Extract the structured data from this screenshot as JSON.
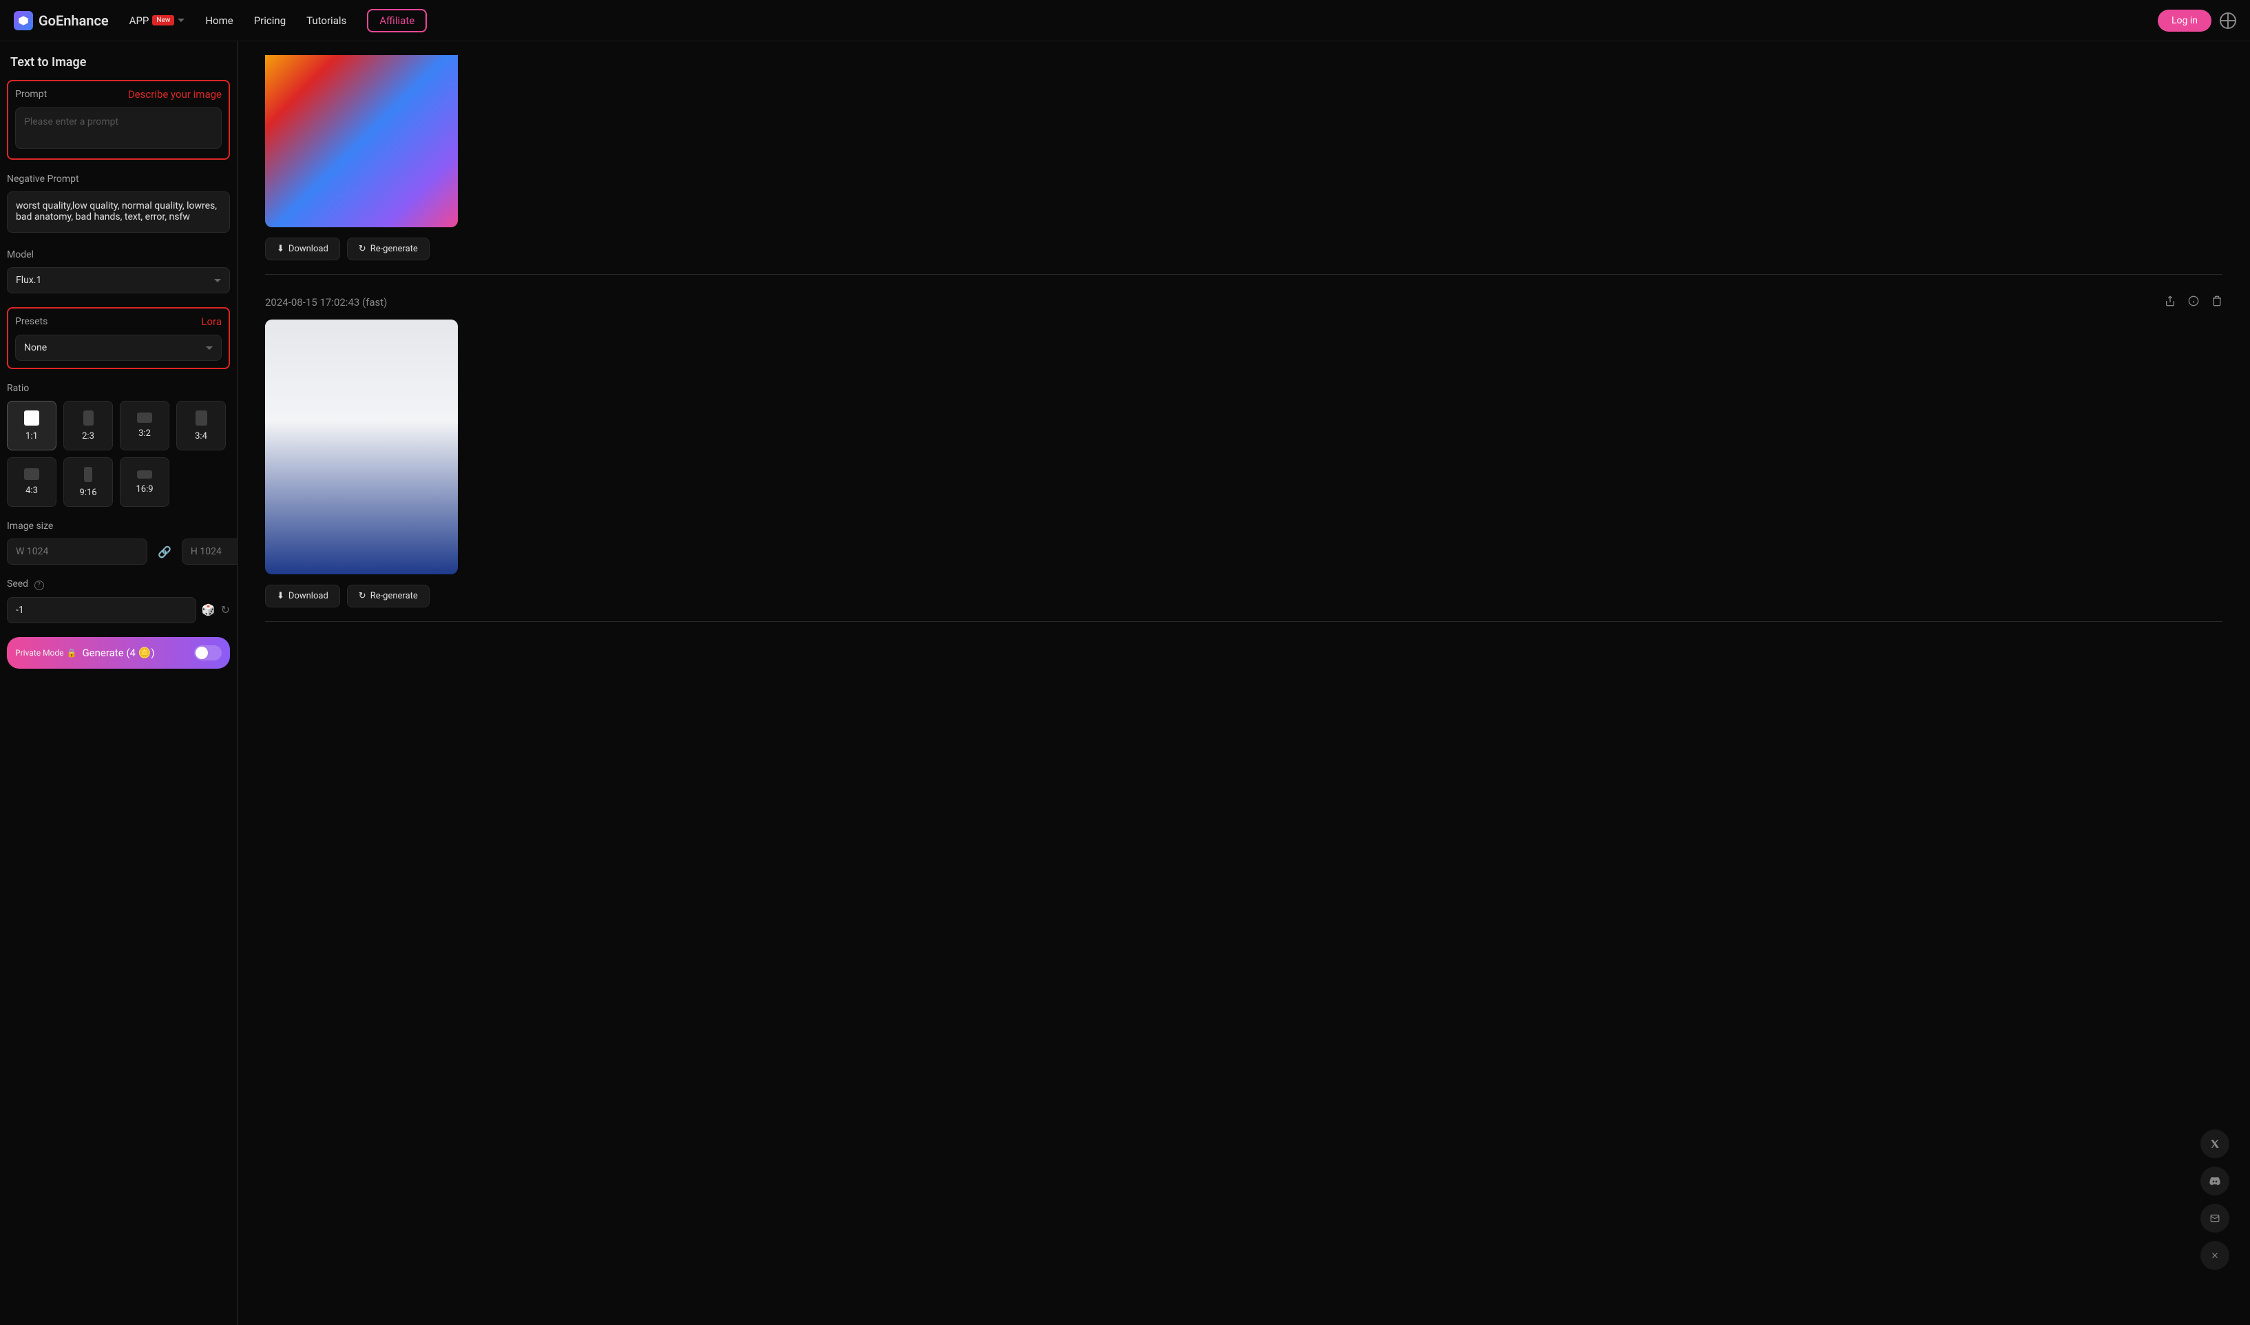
{
  "header": {
    "logo_text": "GoEnhance",
    "app_label": "APP",
    "new_badge": "New",
    "nav": {
      "home": "Home",
      "pricing": "Pricing",
      "tutorials": "Tutorials",
      "affiliate": "Affiliate"
    },
    "login": "Log in"
  },
  "sidebar": {
    "title": "Text to Image",
    "prompt": {
      "label": "Prompt",
      "callout": "Describe your image",
      "placeholder": "Please enter a prompt",
      "value": ""
    },
    "negative_prompt": {
      "label": "Negative Prompt",
      "value": "worst quality,low quality, normal quality, lowres, bad anatomy, bad hands, text, error, nsfw"
    },
    "model": {
      "label": "Model",
      "value": "Flux.1"
    },
    "presets": {
      "label": "Presets",
      "callout": "Lora",
      "value": "None"
    },
    "ratio": {
      "label": "Ratio",
      "options": [
        "1:1",
        "2:3",
        "3:2",
        "3:4",
        "4:3",
        "9:16",
        "16:9"
      ]
    },
    "image_size": {
      "label": "Image size",
      "width_placeholder": "W 1024",
      "height_placeholder": "H 1024"
    },
    "seed": {
      "label": "Seed",
      "value": "-1"
    },
    "generate": {
      "private_mode": "Private Mode",
      "label": "Generate (4 🪙)"
    }
  },
  "content": {
    "items": [
      {
        "download": "Download",
        "regenerate": "Re-generate"
      },
      {
        "timestamp": "2024-08-15 17:02:43 (fast)",
        "download": "Download",
        "regenerate": "Re-generate"
      }
    ]
  }
}
